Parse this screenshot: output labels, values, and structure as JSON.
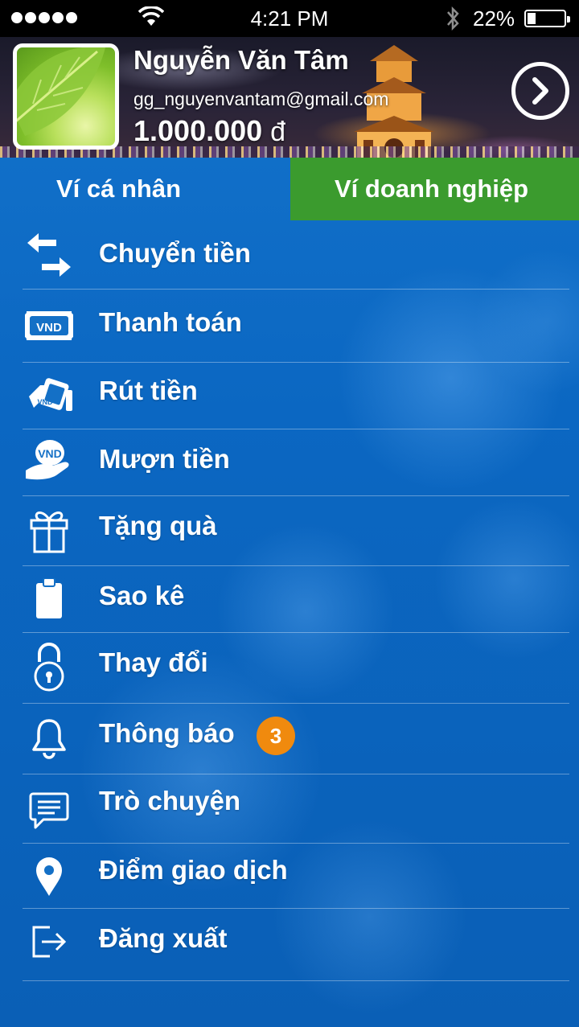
{
  "status_bar": {
    "time": "4:21 PM",
    "battery_percent": "22%",
    "battery_level": 0.22,
    "signal_bars": 5
  },
  "profile": {
    "name": "Nguyễn Văn Tâm",
    "email": "gg_nguyenvantam@gmail.com",
    "balance": "1.000.000",
    "currency": "đ"
  },
  "tabs": [
    {
      "label": "Ví cá nhân",
      "active": false
    },
    {
      "label": "Ví doanh nghiệp",
      "active": true
    }
  ],
  "menu": {
    "items": [
      {
        "label": "Chuyển tiền",
        "icon": "transfer-arrows-icon"
      },
      {
        "label": "Thanh toán",
        "icon": "vnd-banknote-icon",
        "icon_text": "VND"
      },
      {
        "label": "Rút tiền",
        "icon": "withdraw-money-icon",
        "icon_text": "VND"
      },
      {
        "label": "Mượn tiền",
        "icon": "borrow-hand-coin-icon",
        "icon_text": "VND"
      },
      {
        "label": "Tặng quà",
        "icon": "gift-icon"
      },
      {
        "label": "Sao kê",
        "icon": "clipboard-icon"
      },
      {
        "label": "Thay đổi",
        "icon": "padlock-icon"
      },
      {
        "label": "Thông báo",
        "icon": "bell-icon",
        "badge": "3"
      },
      {
        "label": "Trò chuyện",
        "icon": "chat-bubble-icon"
      },
      {
        "label": "Điểm giao dịch",
        "icon": "location-pin-icon"
      },
      {
        "label": "Đăng xuất",
        "icon": "logout-icon"
      }
    ]
  },
  "colors": {
    "tab_active_bg": "#3b9b2e",
    "background_blue": "#0b67c2",
    "badge": "#f08a0e"
  }
}
